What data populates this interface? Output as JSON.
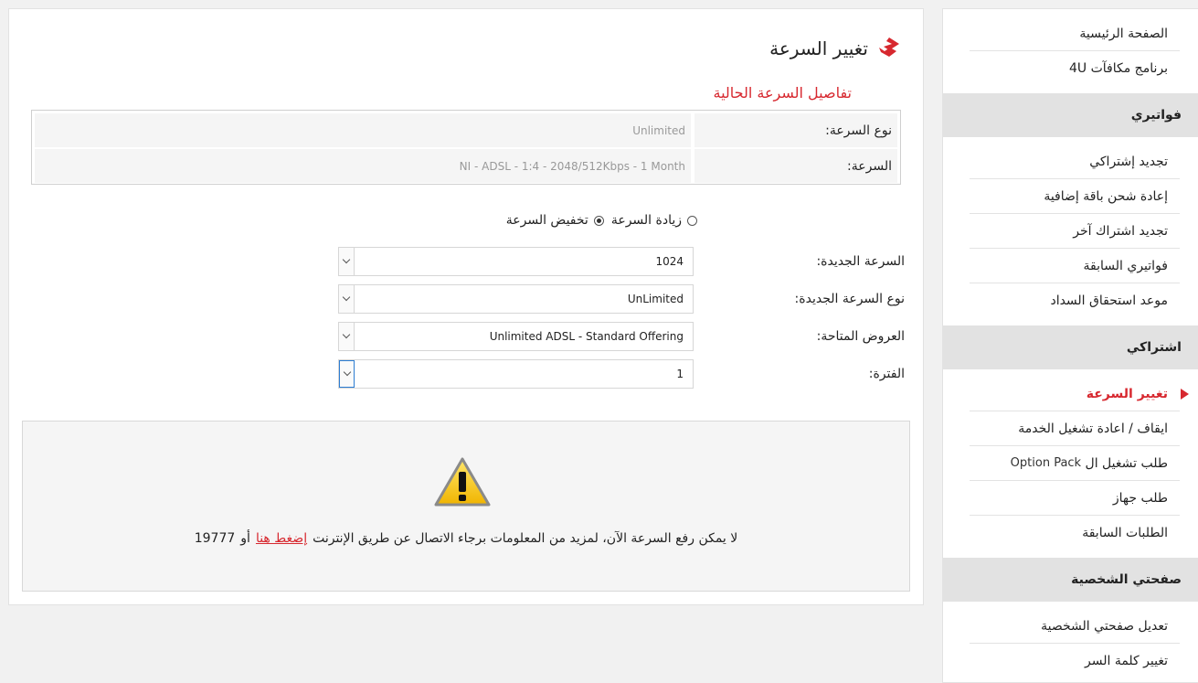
{
  "sidebar": {
    "top_items": [
      {
        "label": "الصفحة الرئيسية"
      },
      {
        "label": "برنامج مكافآت 4U"
      }
    ],
    "sections": [
      {
        "title": "فواتيري",
        "items": [
          {
            "label": "تجديد إشتراكي"
          },
          {
            "label": "إعادة شحن باقة إضافية"
          },
          {
            "label": "تجديد اشتراك آخر"
          },
          {
            "label": "فواتيري السابقة"
          },
          {
            "label": "موعد استحقاق السداد"
          }
        ]
      },
      {
        "title": "اشتراكي",
        "items": [
          {
            "label": "تغيير السرعة",
            "active": true
          },
          {
            "label": "ايقاف / اعادة تشغيل الخدمة"
          },
          {
            "label_ar": "طلب تشغيل ال",
            "label_en": "Option Pack"
          },
          {
            "label": "طلب جهاز"
          },
          {
            "label": "الطلبات السابقة"
          }
        ]
      },
      {
        "title": "صفحتي الشخصية",
        "items": [
          {
            "label": "تعديل صفحتي الشخصية"
          },
          {
            "label": "تغيير كلمة السر"
          }
        ]
      }
    ]
  },
  "main": {
    "title": "تغيير السرعة",
    "current_speed": {
      "label": "تفاصيل السرعة الحالية",
      "rows": [
        {
          "key": "نوع السرعة:",
          "value": "Unlimited"
        },
        {
          "key": "السرعة:",
          "value": "NI - ADSL - 1:4 - 2048/512Kbps - 1 Month"
        }
      ]
    },
    "speed_options": {
      "increase": "زيادة السرعة",
      "decrease": "تخفيض السرعة",
      "selected": "decrease"
    },
    "form": {
      "new_speed": {
        "label": "السرعة الجديدة:",
        "value": "1024"
      },
      "new_speed_type": {
        "label": "نوع السرعة الجديدة:",
        "value": "UnLimited"
      },
      "offers": {
        "label": "العروض المتاحة:",
        "value": "Unlimited ADSL - Standard Offering"
      },
      "period": {
        "label": "الفترة:",
        "value": "1"
      }
    },
    "notice": {
      "icon": "warning-icon",
      "text": "لا يمكن رفع السرعة الآن، لمزيد من المعلومات برجاء الاتصال عن طريق الإنترنت",
      "link": "إضغط هنا",
      "or": "أو",
      "phone": "19777"
    }
  },
  "colors": {
    "accent": "#d7282f",
    "panel_bg": "#f5f5f5",
    "header_bg": "#e2e2e2"
  }
}
